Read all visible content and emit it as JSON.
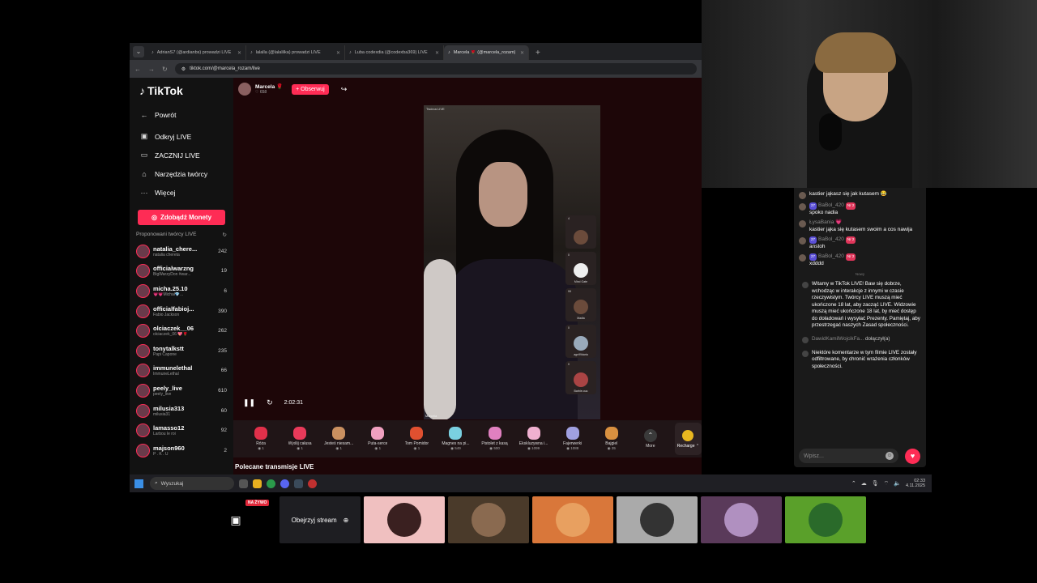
{
  "browser": {
    "tabs": [
      {
        "title": "AdrianS7 (@ardianbs) prowadzi LIVE"
      },
      {
        "title": "lalalla (@lalalilka) prowadzi LIVE"
      },
      {
        "title": "Luba codexdia (@codexba369) LIVE"
      },
      {
        "title": "Marcela 🌹 (@marcela_rozam)"
      }
    ],
    "url": "tiktok.com/@marcela_rozam/live"
  },
  "tiktok": {
    "logo": "TikTok",
    "nav": [
      {
        "label": "Powrót",
        "icon": "←"
      },
      {
        "label": "Odkryj LIVE",
        "icon": "▣"
      },
      {
        "label": "ZACZNIJ LIVE",
        "icon": "▭"
      },
      {
        "label": "Narzędzia twórcy",
        "icon": "⌂"
      },
      {
        "label": "Więcej",
        "icon": "···"
      }
    ],
    "coins_button": "Zdobądź Monety",
    "suggested_title": "Proponowani twórcy LIVE",
    "creators": [
      {
        "name": "natalia_chere...",
        "sub": "natalia chereta",
        "viewers": "242"
      },
      {
        "name": "officialwarzng",
        "sub": "BigWarzyDon #war...",
        "viewers": "19"
      },
      {
        "name": "micha.25.10",
        "sub": "💗💗Michał💎...",
        "viewers": "6"
      },
      {
        "name": "officialfabioj...",
        "sub": "Fabio Jackson",
        "viewers": "390"
      },
      {
        "name": "olciaczek__06",
        "sub": "olciaczek_06 💖🌹",
        "viewers": "262"
      },
      {
        "name": "tonytalkstt",
        "sub": "Papi Capone",
        "viewers": "235"
      },
      {
        "name": "immunelethal",
        "sub": "ImmuneLethal",
        "viewers": "66"
      },
      {
        "name": "peely_live",
        "sub": "peely_live",
        "viewers": "610"
      },
      {
        "name": "milusia313",
        "sub": "milusia31",
        "viewers": "60"
      },
      {
        "name": "lamasso12",
        "sub": "Larbou le roi",
        "viewers": "92"
      },
      {
        "name": "majson960",
        "sub": "P . K . U",
        "viewers": "2"
      }
    ],
    "stream": {
      "host_name": "Marcela 🌹",
      "host_likes": "♡ 658",
      "follow_label": "+ Obserwuj",
      "video_label": "Twórca LIVE",
      "video_name": "Marcela",
      "time": "2:02:31"
    },
    "guests": [
      {
        "badge": "4",
        "name": ""
      },
      {
        "badge": "0",
        "name": "Mind Gate"
      },
      {
        "badge": "99",
        "name": "Madla"
      },
      {
        "badge": "0",
        "name": "agn99daria"
      },
      {
        "badge": "0",
        "name": "Barbie.ouu"
      }
    ],
    "gifts": [
      {
        "name": "Róża",
        "price": "1",
        "color": "#e0304a"
      },
      {
        "name": "Wyślij całusa",
        "price": "1",
        "color": "#e83a5a"
      },
      {
        "name": "Jesteś niesam...",
        "price": "1",
        "color": "#c99060"
      },
      {
        "name": "Puta-serce",
        "price": "1",
        "color": "#f0a0c0"
      },
      {
        "name": "Tom Pomidor",
        "price": "1",
        "color": "#e05030"
      },
      {
        "name": "Magnes na pi...",
        "price": "549",
        "color": "#7ad0e0"
      },
      {
        "name": "Pistolet z kasą",
        "price": "500",
        "color": "#e080c0"
      },
      {
        "name": "Ekskluzywna i...",
        "price": "1099",
        "color": "#f0b0d0"
      },
      {
        "name": "Fajerwerki",
        "price": "1088",
        "color": "#a0a0e0"
      },
      {
        "name": "Bajgiel",
        "price": "35",
        "color": "#d89040"
      }
    ],
    "more_label": "More",
    "recharge_label": "Recharge ⌃",
    "recommended": "Polecane transmisje LIVE"
  },
  "chat": {
    "messages": [
      {
        "user": "",
        "text": "kastier jąkasz się jak kutasem 😂",
        "badges": false
      },
      {
        "user": "BaBol_420",
        "text": "spoko nadia",
        "badges": true
      },
      {
        "user": "ŁysaBania 💗",
        "text": "kastier jąka się kutasem swoim a cos nawija",
        "badges": false
      },
      {
        "user": "BaBol_420",
        "text": "anstoh",
        "badges": true
      },
      {
        "user": "BaBol_420",
        "text": "xdddd",
        "badges": true
      }
    ],
    "badge_level": "27",
    "badge_rank": "Nr 2",
    "divider": "Nowy",
    "welcome": "Witamy w TikTok LIVE! Baw się dobrze, wchodząc w interakcje z innymi w czasie rzeczywistym. Twórcy LIVE muszą mieć ukończone 18 lat, aby zacząć LIVE. Widzowie muszą mieć ukończone 18 lat, by mieć dostęp do doładowań i wysyłać Prezenty. Pamiętaj, aby przestrzegać naszych Zasad społeczności.",
    "joined_user": "DawidKamilWojcikFa...",
    "joined_text": "dołączył(a)",
    "filter_notice": "Niektóre komentarze w tym filmie LIVE zostały odfiltrowane, by chronić wrażenia członków społeczności.",
    "input_placeholder": "Wpisz..."
  },
  "taskbar": {
    "search": "Wyszukaj",
    "time": "02:33",
    "date": "4.11.2025"
  },
  "bottombar": {
    "live_badge": "NA ŻYWO",
    "watch_label": "Obejrzyj stream",
    "avatar_colors": [
      "#f0c0c0",
      "#4a3a2a",
      "#d9773a",
      "#aaaaaa",
      "#5a3a5a",
      "#5aa02a"
    ]
  }
}
